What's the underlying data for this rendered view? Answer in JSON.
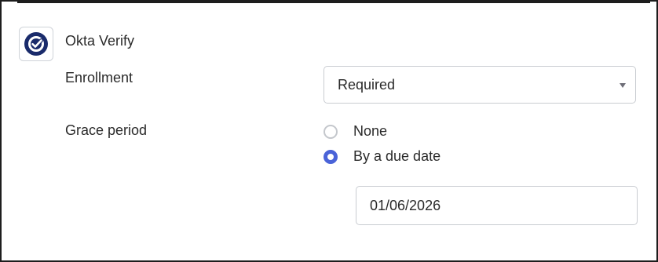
{
  "authenticator": {
    "name": "Okta Verify",
    "icon": "okta-verify-icon",
    "brand_color": "#1a2b6b"
  },
  "enrollment": {
    "label": "Enrollment",
    "selected": "Required"
  },
  "grace_period": {
    "label": "Grace period",
    "options": [
      {
        "label": "None",
        "selected": false
      },
      {
        "label": "By a due date",
        "selected": true
      }
    ],
    "due_date": "01/06/2026"
  },
  "colors": {
    "radio_selected": "#4a63d8",
    "border": "#c9ccd1"
  }
}
